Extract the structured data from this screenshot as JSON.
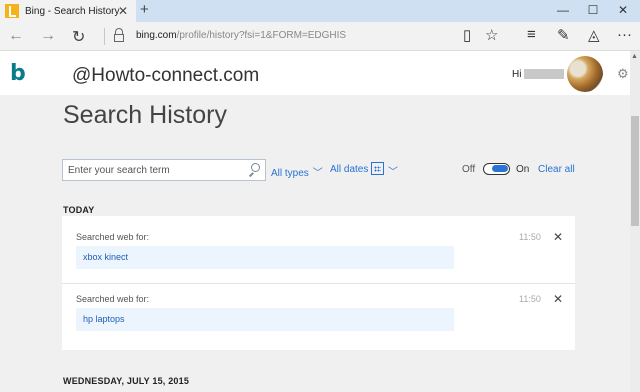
{
  "browser": {
    "tab_title": "Bing - Search History",
    "close_glyph": "✕",
    "new_tab_glyph": "+",
    "url_host": "bing.com",
    "url_rest": "/profile/history?fsi=1&FORM=EDGHIS",
    "minimize_glyph": "—",
    "maximize_glyph": "☐",
    "window_close_glyph": "✕",
    "back_glyph": "←",
    "forward_glyph": "→",
    "refresh_glyph": "↻",
    "reading_view_glyph": "▯",
    "favorite_glyph": "☆",
    "hub_glyph": "≡",
    "note_glyph": "✎",
    "share_glyph": "◬",
    "more_glyph": "···"
  },
  "header": {
    "logo": "b",
    "watermark": "@Howto-connect.com",
    "greeting": "Hi",
    "settings_glyph": "⚙"
  },
  "page": {
    "title": "Search History"
  },
  "search": {
    "placeholder": "Enter your search term",
    "value": ""
  },
  "filters": {
    "types_label": "All types",
    "dates_label": "All dates",
    "chevron": "﹀"
  },
  "history_toggle": {
    "off_label": "Off",
    "on_label": "On",
    "state": "on"
  },
  "clear_all_label": "Clear all",
  "sections": [
    {
      "heading": "TODAY",
      "entries": [
        {
          "label": "Searched web for:",
          "query": "xbox kinect",
          "time": "11:50",
          "remove": "✕"
        },
        {
          "label": "Searched web for:",
          "query": "hp laptops",
          "time": "11:50",
          "remove": "✕"
        }
      ]
    },
    {
      "heading": "WEDNESDAY, JULY 15, 2015",
      "entries": []
    }
  ],
  "colors": {
    "accent": "#2873d4",
    "tabbar": "#cfe0f2",
    "page_bg": "#f0f0f0",
    "query_bg": "#ecf4fd"
  }
}
